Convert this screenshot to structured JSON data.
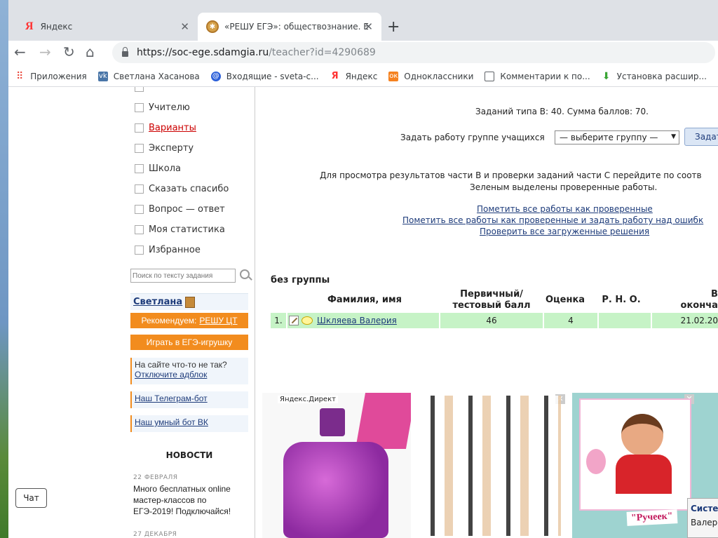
{
  "browser": {
    "tabs": [
      {
        "title": "Яндекс"
      },
      {
        "title": "«РЕШУ ЕГЭ»: обществознание. Е"
      }
    ],
    "url_host": "https://soc-ege.sdamgia.ru",
    "url_path": "/teacher?id=4290689",
    "bookmarks": [
      {
        "label": "Приложения",
        "icon": "apps-grid-icon",
        "color": "#e94235"
      },
      {
        "label": "Светлана Хасанова",
        "icon": "vk-icon",
        "color": "#4a76a8"
      },
      {
        "label": "Входящие - sveta-c...",
        "icon": "mail-icon",
        "color": "#2b5fd9"
      },
      {
        "label": "Яндекс",
        "icon": "yandex-icon",
        "color": "#f33"
      },
      {
        "label": "Одноклассники",
        "icon": "ok-icon",
        "color": "#f58220"
      },
      {
        "label": "Комментарии к по...",
        "icon": "page-icon",
        "color": "#5f6368"
      },
      {
        "label": "Установка расшир...",
        "icon": "download-icon",
        "color": "#3aa535"
      }
    ]
  },
  "sidebar": {
    "menu": [
      {
        "label": "Учителю",
        "red": false
      },
      {
        "label": "Варианты",
        "red": true
      },
      {
        "label": "Эксперту",
        "red": false
      },
      {
        "label": "Школа",
        "red": false
      },
      {
        "label": "Сказать спасибо",
        "red": false
      },
      {
        "label": "Вопрос — ответ",
        "red": false
      },
      {
        "label": "Моя статистика",
        "red": false
      },
      {
        "label": "Избранное",
        "red": false
      }
    ],
    "search_placeholder": "Поиск по тексту задания",
    "user_name": "Светлана",
    "recommend_prefix": "Рекомендуем:",
    "recommend_link": "РЕШУ ЦТ",
    "game_button": "Играть в ЕГЭ-игрушку",
    "adblock_text": "На сайте что-то не так?",
    "adblock_link": "Отключите адблок",
    "telegram_link": "Наш Телеграм-бот",
    "vk_link": "Наш умный бот ВК",
    "news_title": "НОВОСТИ",
    "news": [
      {
        "date": "22 ФЕВРАЛЯ",
        "text": "Много бесплатных online мастер-классов по ЕГЭ-2019! Подключайся!"
      },
      {
        "date": "27 ДЕКАБРЯ",
        "text": ""
      }
    ]
  },
  "chat_label": "Чат",
  "main": {
    "summary": "Заданий типа B: 40. Сумма баллов: 70.",
    "assign_label": "Задать работу группе учащихся",
    "group_select": "— выберите группу —",
    "assign_button": "Задат",
    "info_line1": "Для просмотра результатов части B и проверки заданий части C перейдите по соотв",
    "info_line2": "Зеленым выделены проверенные работы.",
    "links": [
      "Пометить все работы как проверенные",
      "Пометить все работы как проверенные и задать работу над ошибк",
      "Проверить все загруженные решения"
    ],
    "group_name": "без группы",
    "table": {
      "headers": {
        "name": "Фамилия, имя",
        "score": "Первичный/ тестовый балл",
        "grade": "Оценка",
        "rno": "Р. Н. О.",
        "time": "Вре окончани"
      },
      "rows": [
        {
          "num": "1.",
          "name": "Шкляева Валерия",
          "score": "46",
          "grade": "4",
          "rno": "",
          "time": "21.02.20"
        }
      ]
    },
    "ads": {
      "label": "Яндекс.Директ",
      "card3_text": "\"Ручеек\"",
      "card4_text1": "Систе",
      "card4_text2": "Валер"
    }
  },
  "colors": {
    "accent_orange": "#f28c1e",
    "row_green": "#c6f3c6",
    "link_blue": "#1d3b7a"
  }
}
